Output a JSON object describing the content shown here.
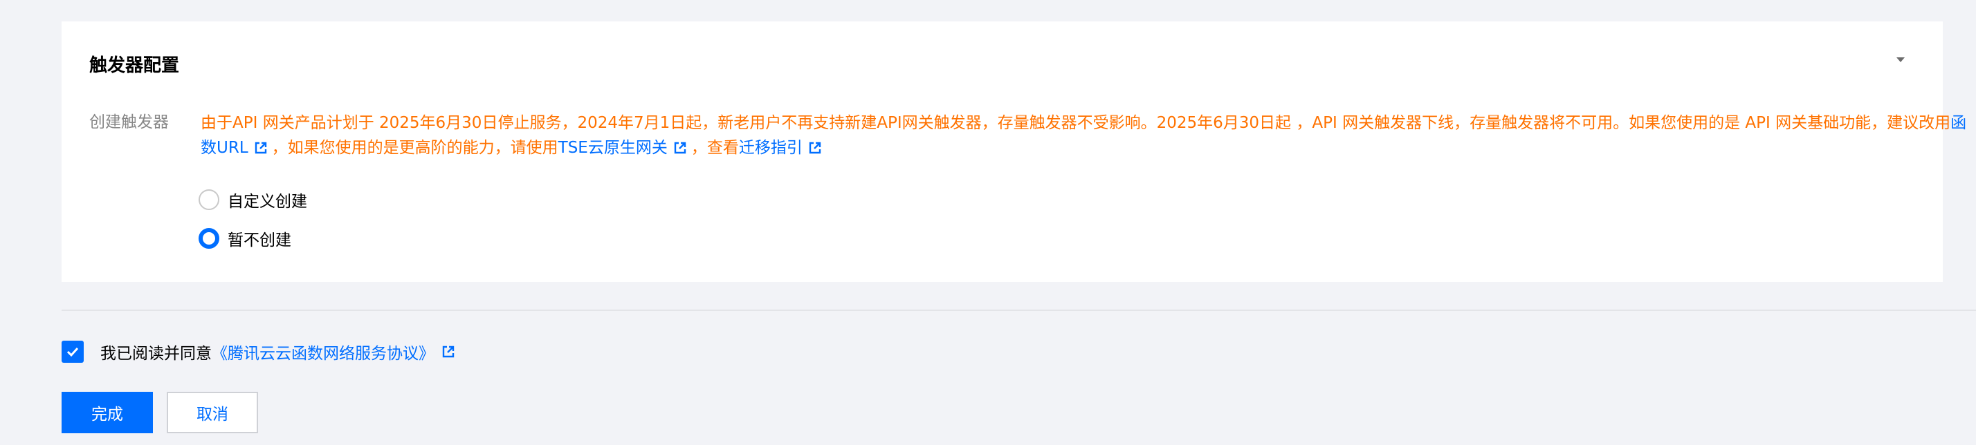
{
  "trigger_config": {
    "title": "触发器配置",
    "collapse_icon": "caret-down-icon",
    "field_label": "创建触发器",
    "notice": {
      "text_1": "由于API 网关产品计划于 2025年6月30日停止服务，2024年7月1日起，新老用户不再支持新建API网关触发器，存量触发器不受影响。2025年6月30日起 ，API 网关触发器下线，存量触发器将不可用。如果您使用的是 API 网关基础功能，建议改用",
      "link_1": "函数URL",
      "text_2": "，如果您使用的是更高阶的能力，请使用",
      "link_2": "TSE云原生网关",
      "text_3": "，查看",
      "link_3": "迁移指引",
      "link_icon": "external-link-icon"
    },
    "options": [
      {
        "label": "自定义创建",
        "checked": false
      },
      {
        "label": "暂不创建",
        "checked": true
      }
    ]
  },
  "agreement": {
    "checked": true,
    "text": "我已阅读并同意",
    "link": "《腾讯云云函数网络服务协议》",
    "link_icon": "external-link-icon"
  },
  "actions": {
    "confirm_label": "完成",
    "cancel_label": "取消"
  },
  "colors": {
    "primary": "#006eff",
    "warning": "#ff7200",
    "background": "#f2f3f7"
  }
}
